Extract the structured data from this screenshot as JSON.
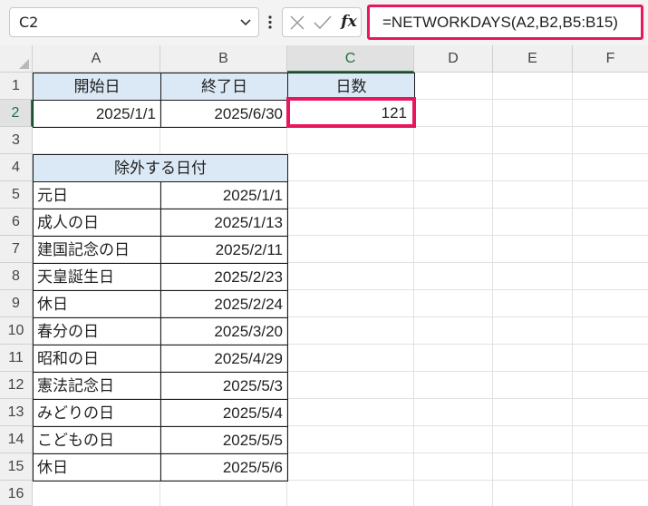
{
  "formula_bar": {
    "name_box": "C2",
    "formula": "=NETWORKDAYS(A2,B2,B5:B15)",
    "fx_label": "fx"
  },
  "columns": [
    "A",
    "B",
    "C",
    "D",
    "E",
    "F"
  ],
  "rows": [
    "1",
    "2",
    "3",
    "4",
    "5",
    "6",
    "7",
    "8",
    "9",
    "10",
    "11",
    "12",
    "13",
    "14",
    "15",
    "16"
  ],
  "header_row": {
    "start": "開始日",
    "end": "終了日",
    "days": "日数"
  },
  "data_row": {
    "start": "2025/1/1",
    "end": "2025/6/30",
    "days": "121"
  },
  "holidays": {
    "title": "除外する日付",
    "items": [
      {
        "name": "元日",
        "date": "2025/1/1"
      },
      {
        "name": "成人の日",
        "date": "2025/1/13"
      },
      {
        "name": "建国記念の日",
        "date": "2025/2/11"
      },
      {
        "name": "天皇誕生日",
        "date": "2025/2/23"
      },
      {
        "name": "休日",
        "date": "2025/2/24"
      },
      {
        "name": "春分の日",
        "date": "2025/3/20"
      },
      {
        "name": "昭和の日",
        "date": "2025/4/29"
      },
      {
        "name": "憲法記念日",
        "date": "2025/5/3"
      },
      {
        "name": "みどりの日",
        "date": "2025/5/4"
      },
      {
        "name": "こどもの日",
        "date": "2025/5/5"
      },
      {
        "name": "休日",
        "date": "2025/5/6"
      }
    ]
  },
  "colors": {
    "highlight": "#e8175d",
    "header_fill": "#dbe8f5",
    "active_header": "#217346"
  }
}
